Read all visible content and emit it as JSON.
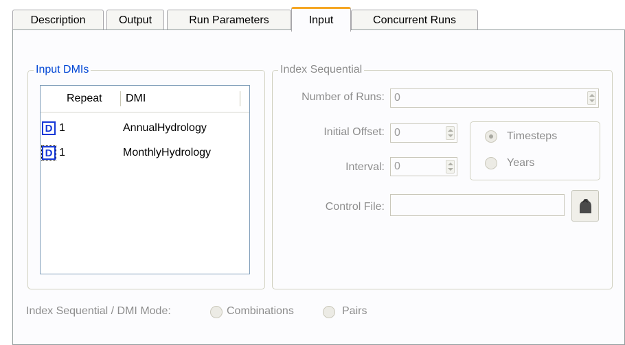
{
  "tabs": [
    {
      "label": "Description"
    },
    {
      "label": "Output"
    },
    {
      "label": "Run Parameters"
    },
    {
      "label": "Input",
      "active": true
    },
    {
      "label": "Concurrent Runs"
    }
  ],
  "input_dmis": {
    "title": "Input DMIs",
    "columns": {
      "repeat": "Repeat",
      "dmi": "DMI"
    },
    "rows": [
      {
        "icon": "D",
        "repeat": "1",
        "dmi": "AnnualHydrology"
      },
      {
        "icon": "D",
        "repeat": "1",
        "dmi": "MonthlyHydrology"
      }
    ]
  },
  "index_sequential": {
    "title": "Index Sequential",
    "number_of_runs": {
      "label": "Number of Runs:",
      "value": "0"
    },
    "initial_offset": {
      "label": "Initial Offset:",
      "value": "0"
    },
    "interval": {
      "label": "Interval:",
      "value": "0"
    },
    "unit_options": [
      {
        "label": "Timesteps",
        "selected": true
      },
      {
        "label": "Years",
        "selected": false
      }
    ],
    "control_file": {
      "label": "Control File:",
      "value": ""
    }
  },
  "dmi_mode": {
    "label": "Index Sequential / DMI Mode:",
    "options": [
      {
        "label": "Combinations",
        "selected": false
      },
      {
        "label": "Pairs",
        "selected": false
      }
    ]
  },
  "colors": {
    "active_tab_accent": "#f5a623",
    "legend_active": "#0046d5",
    "disabled_text": "#8d8d8d",
    "dmi_icon": "#1538d8"
  }
}
